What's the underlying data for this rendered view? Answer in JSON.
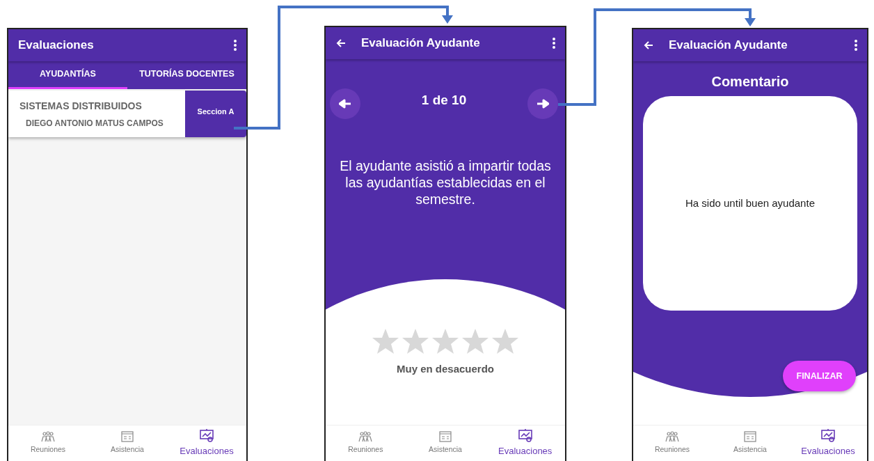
{
  "screens": [
    {
      "kind": "list",
      "app_bar": {
        "title": "Evaluaciones"
      },
      "tabs": [
        {
          "label": "AYUDANTÍAS",
          "selected": true
        },
        {
          "label": "TUTORÍAS DOCENTES",
          "selected": false
        }
      ],
      "courses": [
        {
          "name": "SISTEMAS DISTRIBUIDOS",
          "teacher": "DIEGO ANTONIO MATUS CAMPOS",
          "section": "Seccion A"
        }
      ],
      "bottom_nav": [
        {
          "label": "Reuniones",
          "selected": false
        },
        {
          "label": "Asistencia",
          "selected": false
        },
        {
          "label": "Evaluaciones",
          "selected": true
        }
      ]
    },
    {
      "kind": "question",
      "app_bar": {
        "title": "Evaluación Ayudante"
      },
      "counter": "1 de 10",
      "question": "El ayudante asistió a impartir todas las ayudantías establecidas en el semestre.",
      "stars": 0,
      "rating_label": "Muy en desacuerdo",
      "bottom_nav": [
        {
          "label": "Reuniones",
          "selected": false
        },
        {
          "label": "Asistencia",
          "selected": false
        },
        {
          "label": "Evaluaciones",
          "selected": true
        }
      ]
    },
    {
      "kind": "comment",
      "app_bar": {
        "title": "Evaluación Ayudante"
      },
      "heading": "Comentario",
      "comment": "Ha sido until buen ayudante",
      "button": "FINALIZAR",
      "bottom_nav": [
        {
          "label": "Reuniones",
          "selected": false
        },
        {
          "label": "Asistencia",
          "selected": false
        },
        {
          "label": "Evaluaciones",
          "selected": true
        }
      ]
    }
  ]
}
